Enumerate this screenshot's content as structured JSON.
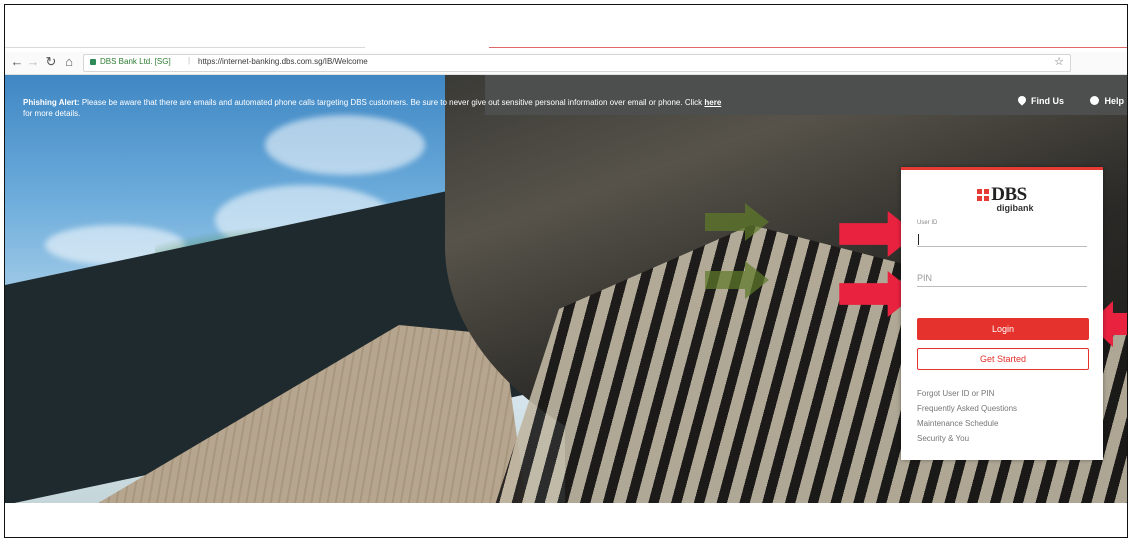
{
  "browser": {
    "site_name": "DBS Bank Ltd. [SG]",
    "url": "https://internet-banking.dbs.com.sg/IB/Welcome",
    "icons": [
      "back-icon",
      "forward-icon",
      "reload-icon",
      "home-icon",
      "lock-icon",
      "star-icon"
    ]
  },
  "header": {
    "alert_label": "Phishing Alert:",
    "alert_text": " Please be aware that there are emails and automated phone calls targeting DBS customers. Be sure to never give out sensitive personal information over email or phone. Click ",
    "alert_link": "here",
    "alert_suffix": "for more details.",
    "find_us": "Find Us",
    "help": "Help &"
  },
  "login": {
    "logo_text": "DBS",
    "logo_sub": "digibank",
    "user_id_label": "User ID",
    "pin_placeholder": "PIN",
    "login_button": "Login",
    "get_started_button": "Get Started",
    "links": [
      "Forgot User ID or PIN",
      "Frequently Asked Questions",
      "Maintenance Schedule",
      "Security & You"
    ]
  },
  "colors": {
    "accent": "#e53b34",
    "arrow_red": "#e8223f",
    "arrow_green": "#5f7a2a"
  }
}
